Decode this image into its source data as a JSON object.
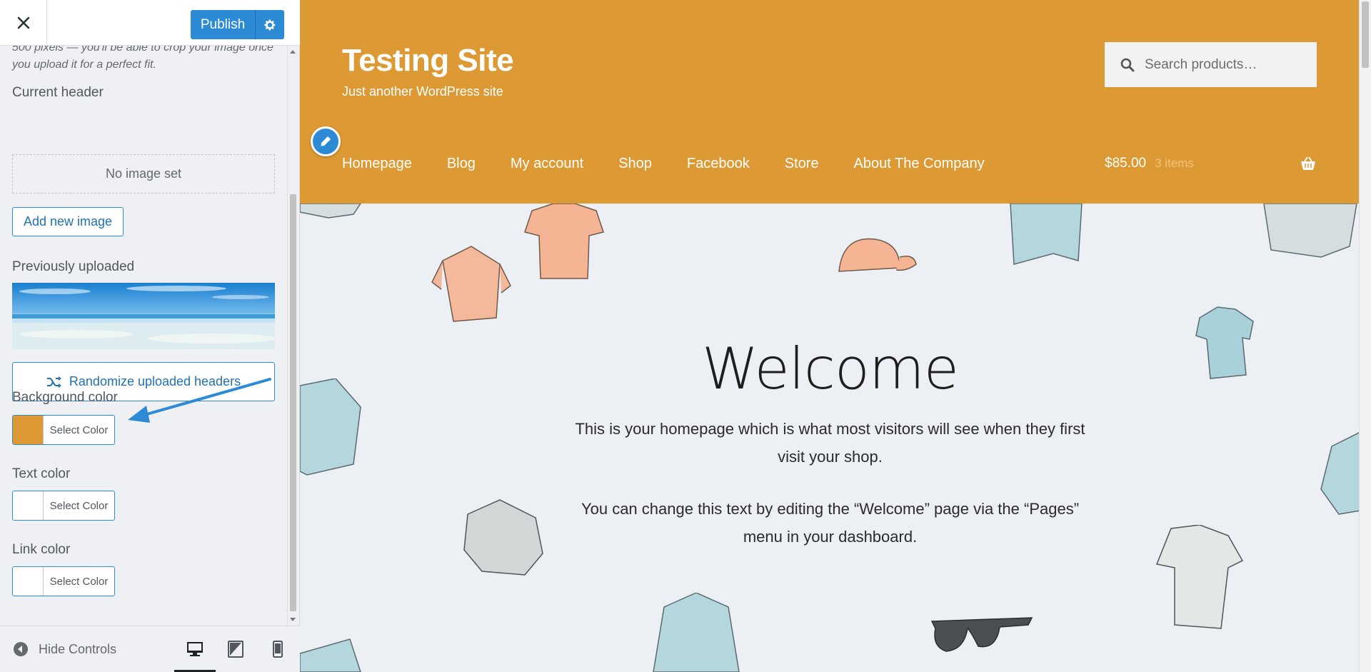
{
  "sidebar": {
    "close_label": "×",
    "publish_label": "Publish",
    "description": "500 pixels — you'll be able to crop your image once you upload it for a perfect fit.",
    "current_header_label": "Current header",
    "no_image_label": "No image set",
    "add_image_label": "Add new image",
    "previously_uploaded_label": "Previously uploaded",
    "randomize_label": "Randomize uploaded headers",
    "background_color_label": "Background color",
    "text_color_label": "Text color",
    "link_color_label": "Link color",
    "select_color_label": "Select Color",
    "background_color_value": "#dd9933",
    "text_color_value": "#ffffff",
    "link_color_value": "#ffffff",
    "hide_controls_label": "Hide Controls"
  },
  "preview": {
    "site_title": "Testing Site",
    "tagline": "Just another WordPress site",
    "search_placeholder": "Search products…",
    "nav": [
      "Homepage",
      "Blog",
      "My account",
      "Shop",
      "Facebook",
      "Store",
      "About The Company"
    ],
    "cart_amount": "$85.00",
    "cart_items": "3 items",
    "welcome_heading": "Welcome",
    "para1": "This is your homepage which is what most visitors will see when they first visit your shop.",
    "para2": "You can change this text by editing the “Welcome” page via the “Pages” menu in your dashboard."
  },
  "colors": {
    "header_bg": "#dd9933",
    "accent": "#2d8ad4",
    "annotation_arrow": "#2d8ad4"
  },
  "icons": [
    "close-icon",
    "gear-icon",
    "shuffle-icon",
    "collapse-icon",
    "desktop-icon",
    "tablet-icon",
    "mobile-icon",
    "search-icon",
    "pencil-icon",
    "basket-icon"
  ]
}
